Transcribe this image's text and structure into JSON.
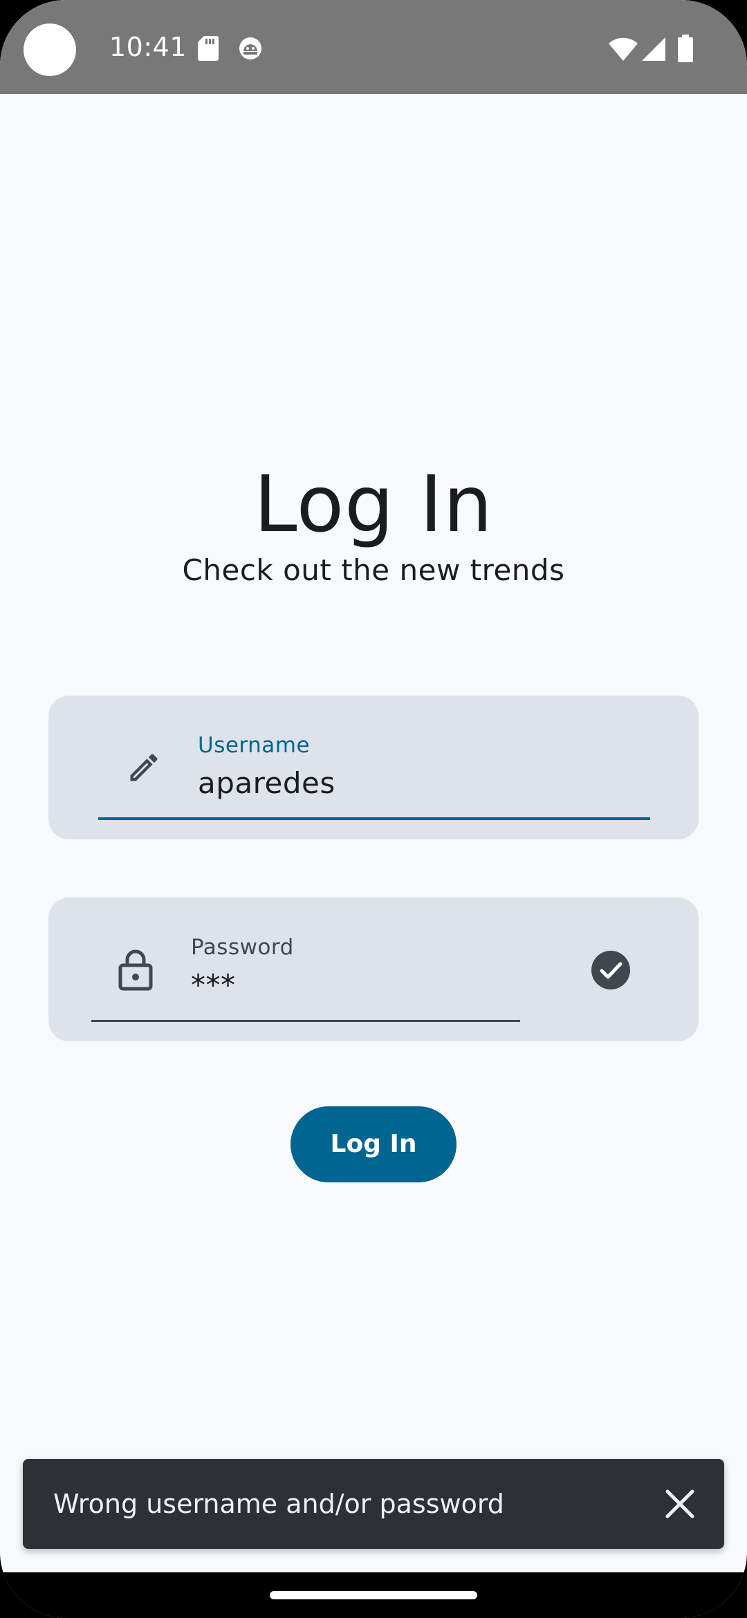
{
  "status_bar": {
    "time": "10:41",
    "icons": [
      "sd-card-icon",
      "android-debug-icon",
      "wifi-icon",
      "cellular-signal-icon",
      "battery-icon"
    ],
    "background": "#787878"
  },
  "login": {
    "title": "Log In",
    "subtitle": "Check out the new trends"
  },
  "username": {
    "label": "Username",
    "value": "aparedes",
    "icon": "pencil-icon",
    "label_color": "#006590",
    "focused": true
  },
  "password": {
    "label": "Password",
    "value": "***",
    "icon": "lock-icon",
    "trailing_icon": "check-circle-icon"
  },
  "login_button": {
    "label": "Log In",
    "color": "#006590"
  },
  "snackbar": {
    "message": "Wrong username and/or password",
    "close_icon": "close-icon"
  },
  "colors": {
    "background": "#f8f9fb",
    "field_background": "#dde3e9",
    "accent": "#006590",
    "snackbar": "#2d3135"
  }
}
